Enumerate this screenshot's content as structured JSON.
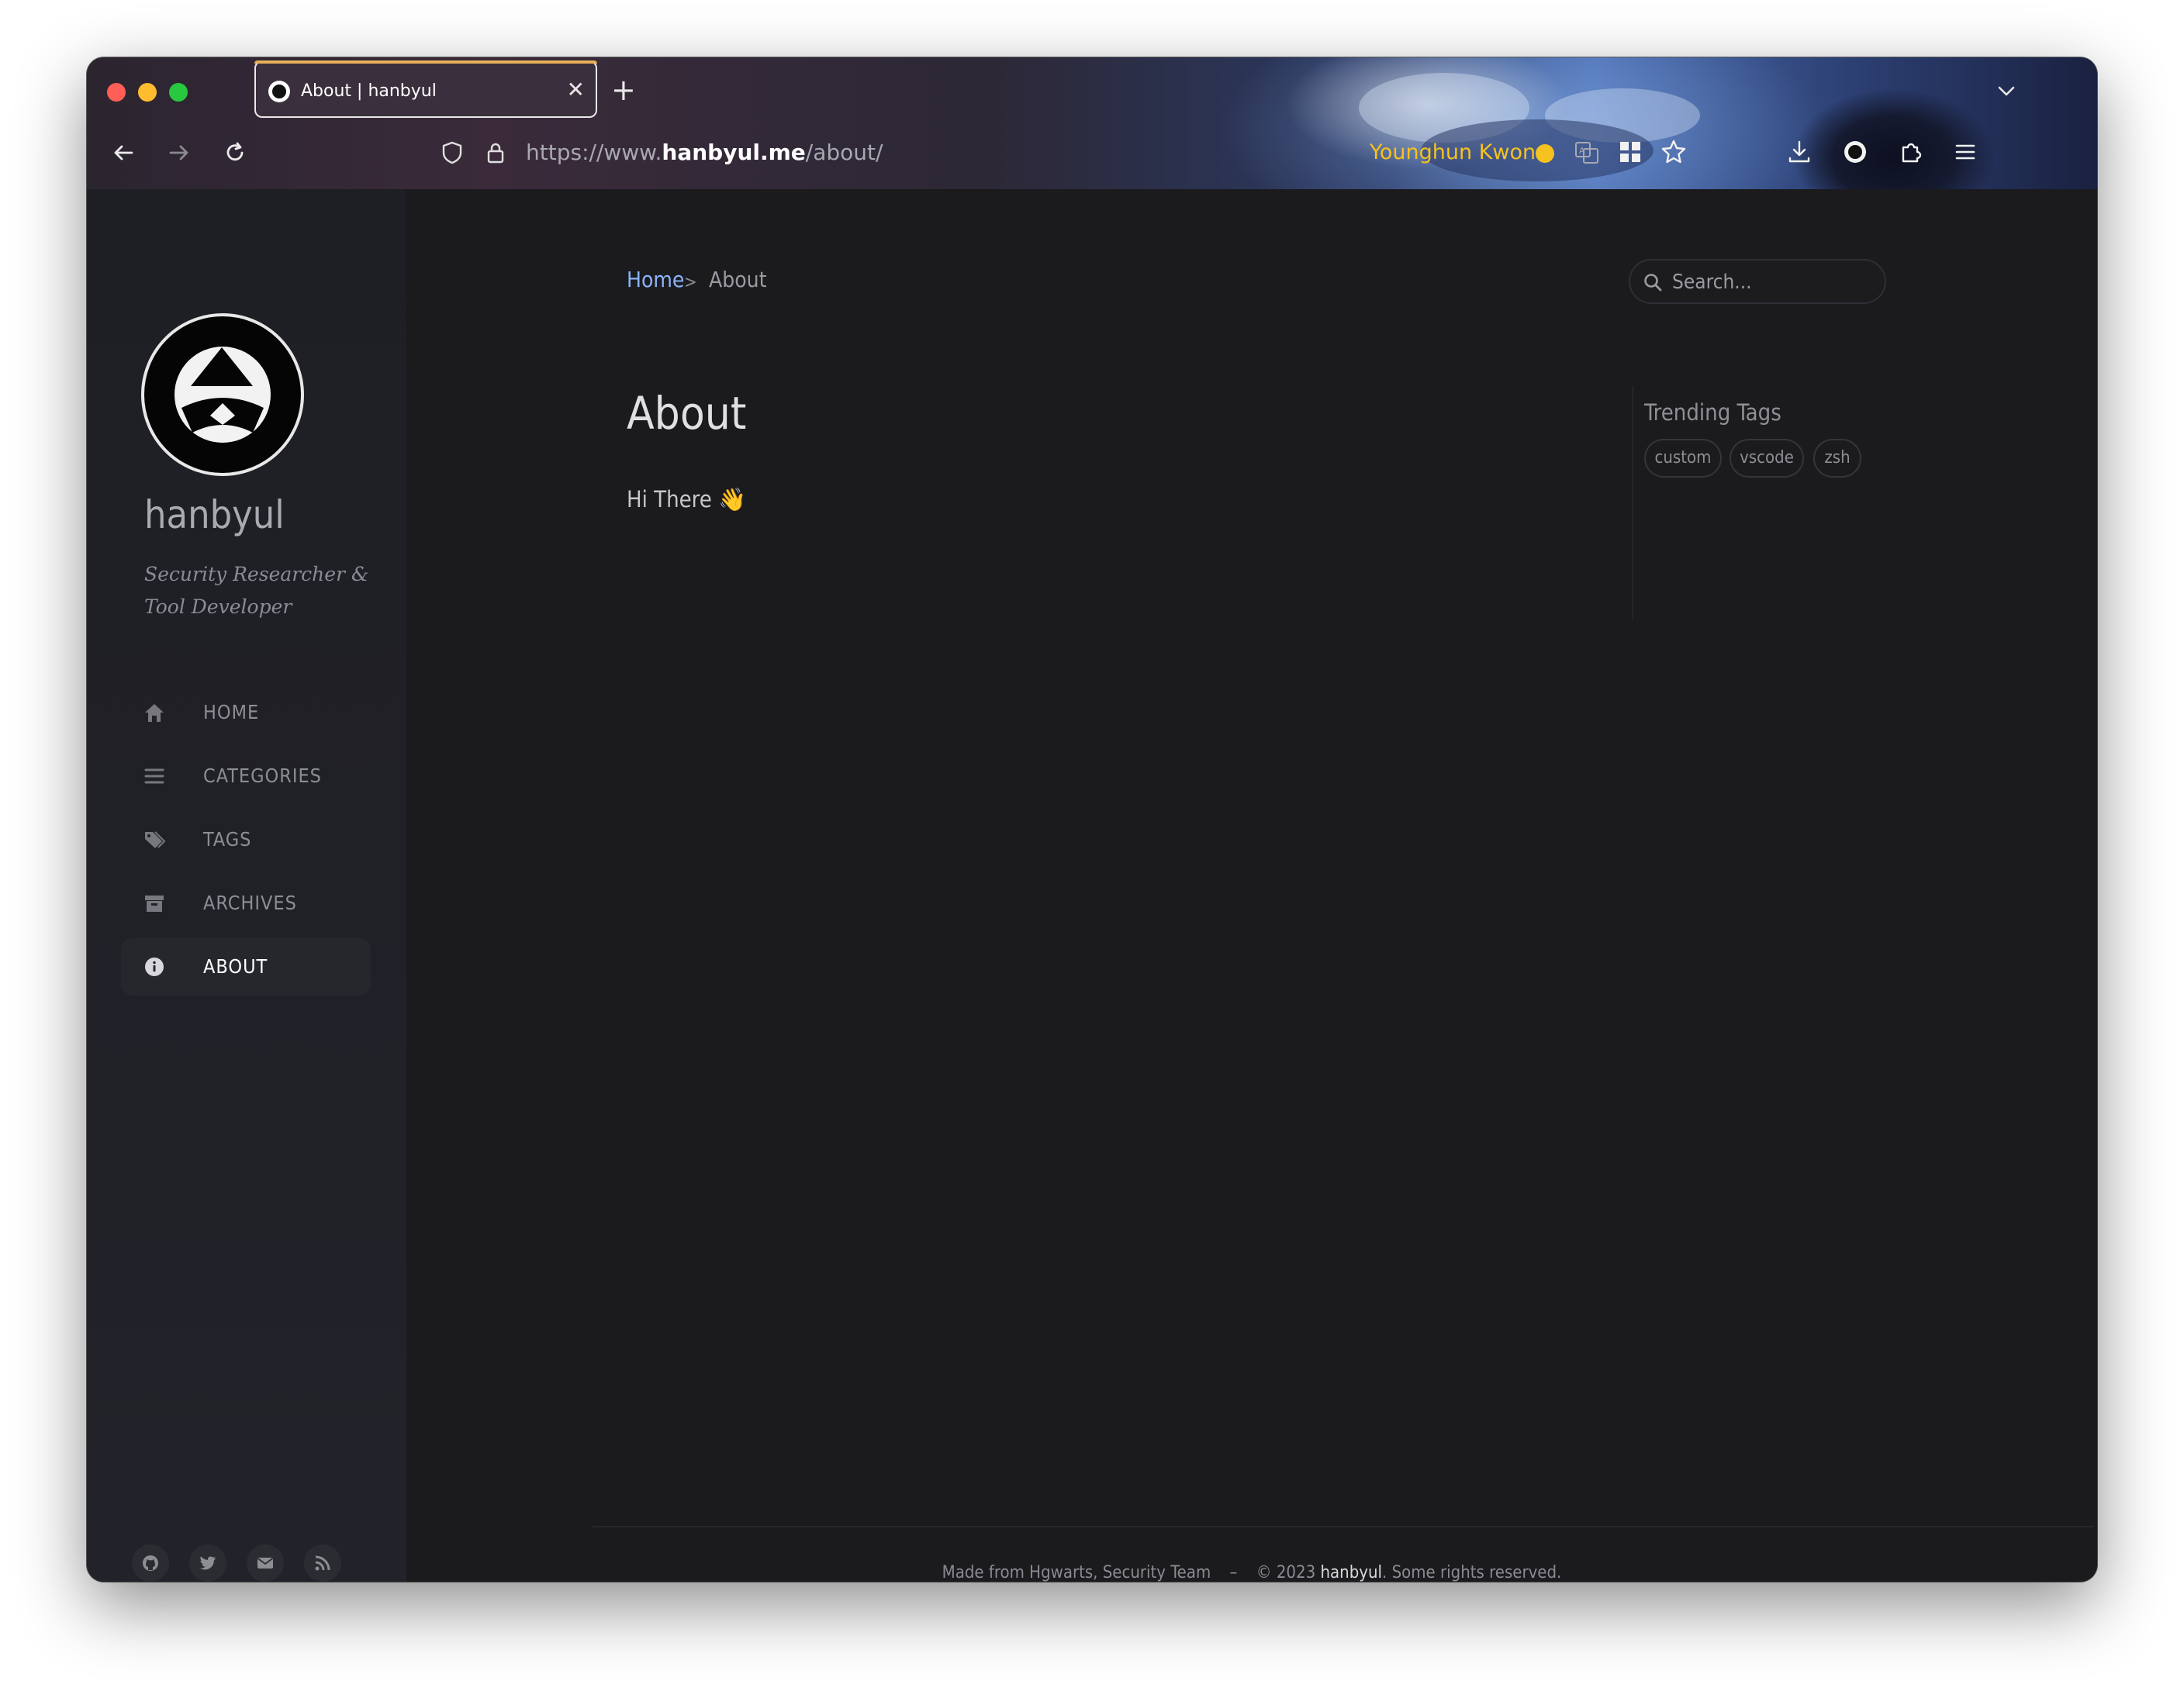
{
  "browser": {
    "tab_title": "About | hanbyul",
    "tab_close": "✕",
    "new_tab": "+",
    "url_scheme": "https://www.",
    "url_host": "hanbyul.me",
    "url_path": "/about/",
    "profile_name": "Younghun Kwon"
  },
  "sidebar": {
    "site_title": "hanbyul",
    "site_subtitle": "Security Researcher & Tool Developer",
    "nav_items": [
      {
        "label": "HOME",
        "icon": "home-icon"
      },
      {
        "label": "CATEGORIES",
        "icon": "list-icon"
      },
      {
        "label": "TAGS",
        "icon": "tags-icon"
      },
      {
        "label": "ARCHIVES",
        "icon": "archive-icon"
      },
      {
        "label": "ABOUT",
        "icon": "info-icon",
        "active": true
      }
    ],
    "social": [
      "github-icon",
      "twitter-icon",
      "email-icon",
      "rss-icon"
    ]
  },
  "main": {
    "breadcrumb": {
      "home": "Home",
      "separator": ">",
      "current": "About"
    },
    "search_placeholder": "Search...",
    "title": "About",
    "content": "Hi There 👋",
    "trending": {
      "title": "Trending Tags",
      "tags": [
        "custom",
        "vscode",
        "zsh"
      ]
    },
    "footer": {
      "made_from": "Made from Hgwarts, Security Team",
      "separator": "–",
      "copyright": "© 2023",
      "owner": "hanbyul",
      "rights": ". Some rights reserved."
    }
  },
  "colors": {
    "link": "#8ab4f8",
    "profile_name": "#f5c21f",
    "main_bg": "#1b1b1e",
    "sidebar_bg": "#1e1f24"
  }
}
